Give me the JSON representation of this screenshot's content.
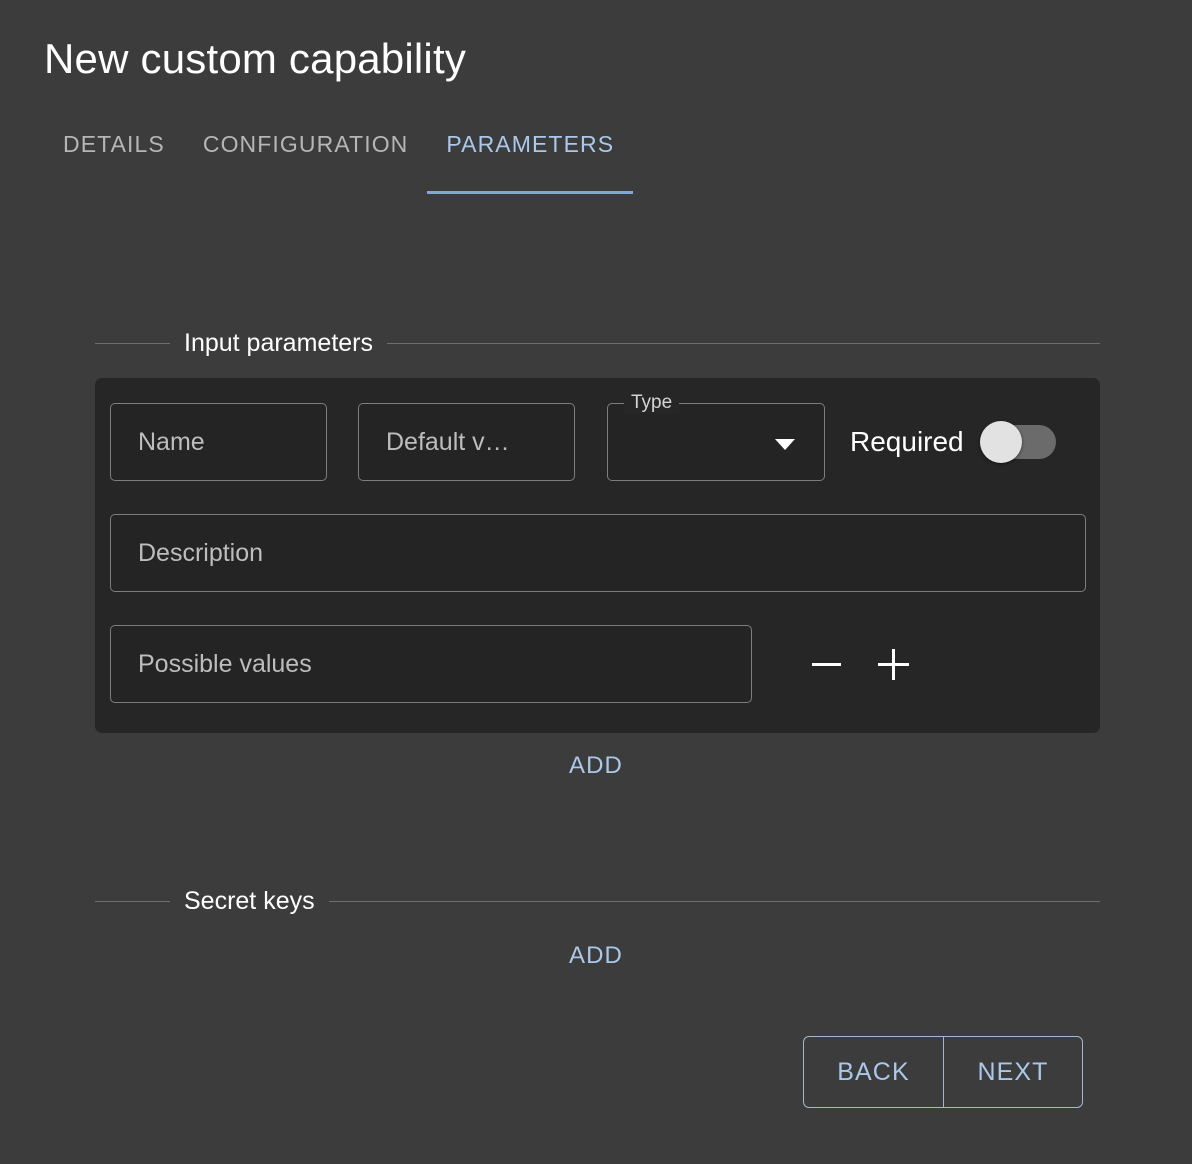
{
  "header": {
    "title": "New custom capability",
    "tabs": [
      {
        "label": "DETAILS",
        "active": false
      },
      {
        "label": "CONFIGURATION",
        "active": false
      },
      {
        "label": "PARAMETERS",
        "active": true
      }
    ]
  },
  "input_parameters": {
    "legend": "Input parameters",
    "row": {
      "name_placeholder": "Name",
      "default_value_placeholder": "Default v…",
      "type_label": "Type",
      "type_value": "",
      "required_label": "Required",
      "required_state": "off",
      "description_placeholder": "Description",
      "possible_values_placeholder": "Possible values",
      "remove_icon": "minus-icon",
      "add_icon": "plus-icon"
    },
    "add_label": "ADD"
  },
  "secret_keys": {
    "legend": "Secret keys",
    "add_label": "ADD"
  },
  "footer": {
    "back_label": "BACK",
    "next_label": "NEXT"
  },
  "colors": {
    "page_background": "#3c3c3c",
    "card_background": "#262626",
    "field_background": "#242424",
    "accent_link": "#a9c8ea",
    "tab_indicator": "#82a9d6",
    "field_border": "#7d7d7d",
    "divider": "#6e6e6e",
    "switch_track": "#6b6b6b",
    "switch_knob": "#e2e2e2"
  }
}
